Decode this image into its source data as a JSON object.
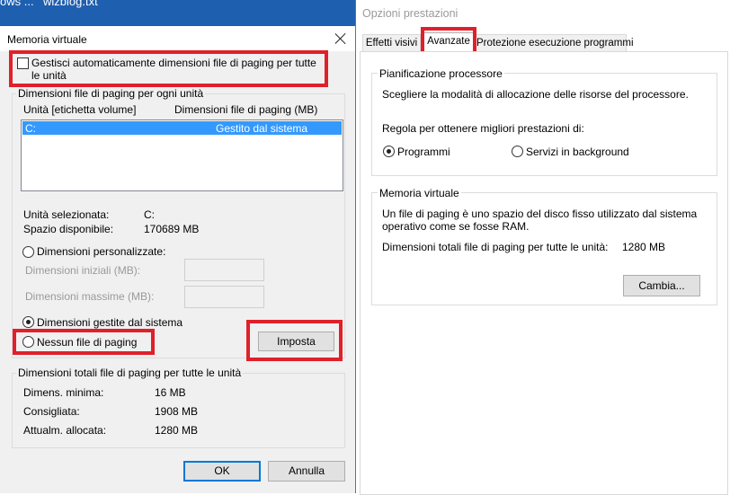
{
  "taskbar": {
    "left_text": "ows ...",
    "file_text": "wizblog.txt"
  },
  "left_dialog": {
    "title": "Memoria virtuale",
    "auto_manage_line1": "Gestisci automaticamente dimensioni file di paging per tutte",
    "auto_manage_line2": "le unità",
    "per_drive_group": "Dimensioni file di paging per ogni unità",
    "col_drive": "Unità  [etichetta volume]",
    "col_size": "Dimensioni file di paging (MB)",
    "drives": [
      {
        "drive": "C:",
        "size": "Gestito dal sistema"
      }
    ],
    "selected_drive_label": "Unità selezionata:",
    "selected_drive_value": "C:",
    "free_space_label": "Spazio disponibile:",
    "free_space_value": "170689 MB",
    "custom_size": "Dimensioni personalizzate:",
    "initial_size": "Dimensioni iniziali (MB):",
    "max_size": "Dimensioni massime (MB):",
    "system_managed": "Dimensioni gestite dal sistema",
    "no_paging": "Nessun file di paging",
    "set_button": "Imposta",
    "totals_group": "Dimensioni totali file di paging per tutte le unità",
    "min_label": "Dimens. minima:",
    "min_value": "16 MB",
    "recommended_label": "Consigliata:",
    "recommended_value": "1908 MB",
    "allocated_label": "Attualm. allocata:",
    "allocated_value": "1280 MB",
    "ok_button": "OK",
    "cancel_button": "Annulla"
  },
  "right_dialog": {
    "title": "Opzioni prestazioni",
    "tabs": [
      "Effetti visivi",
      "Avanzate",
      "Protezione esecuzione programmi"
    ],
    "scheduling_group": "Pianificazione processore",
    "scheduling_desc": "Scegliere la modalità di allocazione delle risorse del processore.",
    "adjust_label": "Regola per ottenere migliori prestazioni di:",
    "opt_programs": "Programmi",
    "opt_background": "Servizi in background",
    "vm_group": "Memoria virtuale",
    "vm_desc_line1": "Un file di paging è uno spazio del disco fisso utilizzato dal sistema",
    "vm_desc_line2": "operativo come se fosse RAM.",
    "vm_total_label": "Dimensioni totali file di paging per tutte le unità:",
    "vm_total_value": "1280 MB",
    "change_button": "Cambia..."
  },
  "colors": {
    "highlight": "#e0202a",
    "selection": "#3399ff",
    "accent": "#0078d7"
  }
}
